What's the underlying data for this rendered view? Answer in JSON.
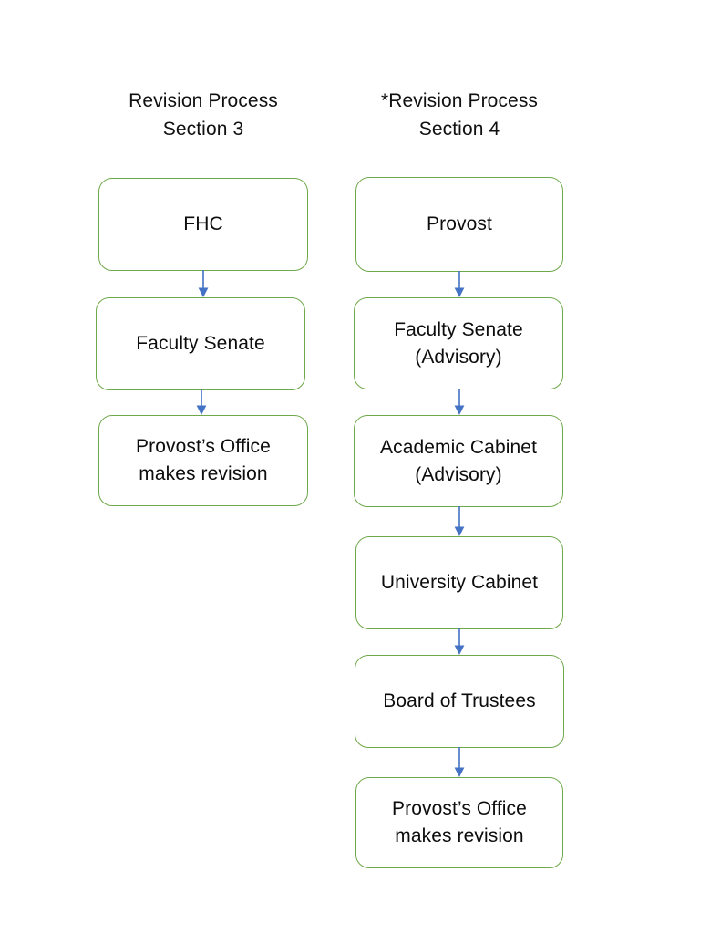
{
  "document": {
    "title": "Revision Process Flowchart",
    "background_color": "#ffffff"
  },
  "style": {
    "node_border_color": "#6fa84a",
    "node_fill_color": "#ffffff",
    "arrow_color": "#4472c4",
    "text_color": "#0d0d0d"
  },
  "columns": [
    {
      "id": "section-3",
      "header": {
        "line1": "Revision Process",
        "line2": "Section 3"
      },
      "nodes": [
        {
          "line1": "FHC",
          "line2": ""
        },
        {
          "line1": "Faculty Senate",
          "line2": ""
        },
        {
          "line1": "Provost’s Office",
          "line2": "makes revision"
        }
      ],
      "connectors": [
        {
          "from": "FHC",
          "to": "Faculty Senate",
          "type": "arrow-down"
        },
        {
          "from": "Faculty Senate",
          "to": "Provost’s Office makes revision",
          "type": "arrow-down"
        }
      ]
    },
    {
      "id": "section-4",
      "header": {
        "line1": "*Revision Process",
        "line2": "Section 4"
      },
      "nodes": [
        {
          "line1": "Provost",
          "line2": ""
        },
        {
          "line1": "Faculty Senate",
          "line2": "(Advisory)"
        },
        {
          "line1": "Academic Cabinet",
          "line2": "(Advisory)"
        },
        {
          "line1": "University Cabinet",
          "line2": ""
        },
        {
          "line1": "Board of Trustees",
          "line2": ""
        },
        {
          "line1": "Provost’s Office",
          "line2": "makes revision"
        }
      ],
      "connectors": [
        {
          "from": "Provost",
          "to": "Faculty Senate (Advisory)",
          "type": "arrow-down"
        },
        {
          "from": "Faculty Senate (Advisory)",
          "to": "Academic Cabinet (Advisory)",
          "type": "arrow-down"
        },
        {
          "from": "Academic Cabinet (Advisory)",
          "to": "University Cabinet",
          "type": "arrow-down"
        },
        {
          "from": "University Cabinet",
          "to": "Board of Trustees",
          "type": "arrow-down"
        },
        {
          "from": "Board of Trustees",
          "to": "Provost’s Office makes revision",
          "type": "arrow-down"
        }
      ]
    }
  ]
}
